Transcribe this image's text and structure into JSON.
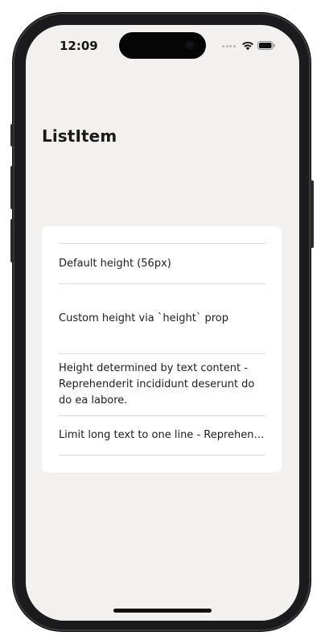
{
  "status_bar": {
    "time": "12:09",
    "icons": [
      "cellular-signal-icon",
      "wifi-icon",
      "battery-icon"
    ]
  },
  "page": {
    "title": "ListItem"
  },
  "list": {
    "items": [
      {
        "label": "Default height (56px)"
      },
      {
        "label": "Custom height via `height` prop"
      },
      {
        "label": "Height determined by text content - Reprehenderit incididunt deserunt do do ea labore."
      },
      {
        "label": "Limit long text to one line - Reprehenderit incididunt deserunt do do ea labore."
      }
    ]
  },
  "colors": {
    "screen_background": "#f2f1ef",
    "card_background": "#ffffff",
    "divider": "#d9d9d9",
    "text": "#1e1e1e"
  }
}
